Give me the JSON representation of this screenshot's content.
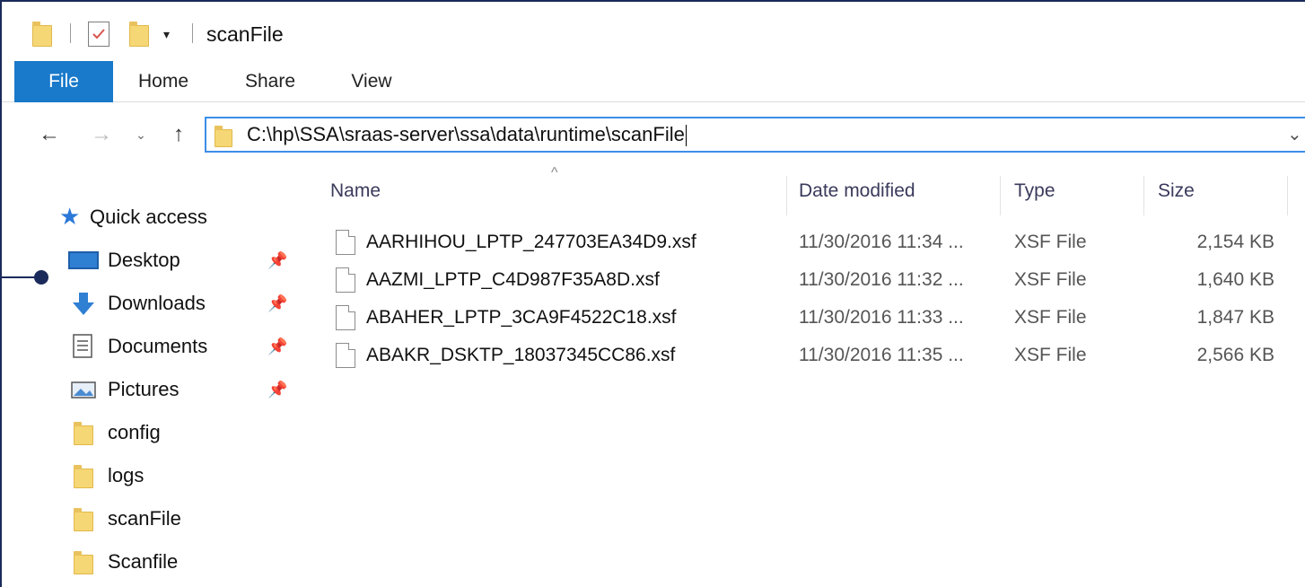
{
  "window": {
    "title": "scanFile",
    "qat_dropdown_glyph": "▾",
    "qat_icons": [
      "folder-icon",
      "properties-icon",
      "new-folder-icon"
    ]
  },
  "ribbon": {
    "tabs": [
      {
        "label": "File",
        "active": true
      },
      {
        "label": "Home"
      },
      {
        "label": "Share"
      },
      {
        "label": "View"
      }
    ],
    "active_color": "#1979ca"
  },
  "nav": {
    "back_glyph": "←",
    "forward_glyph": "→",
    "recent_glyph": "⌄",
    "up_glyph": "↑",
    "address_path": "C:\\hp\\SSA\\sraas-server\\ssa\\data\\runtime\\scanFile",
    "address_dropdown_glyph": "⌄"
  },
  "navpane": {
    "quick_access": {
      "label": "Quick access",
      "icon": "star-icon"
    },
    "pinned": [
      {
        "label": "Desktop",
        "icon": "desktop-icon",
        "pin": "📌"
      },
      {
        "label": "Downloads",
        "icon": "downloads-icon",
        "pin": "📌"
      },
      {
        "label": "Documents",
        "icon": "documents-icon",
        "pin": "📌"
      },
      {
        "label": "Pictures",
        "icon": "pictures-icon",
        "pin": "📌"
      }
    ],
    "folders": [
      {
        "label": "config",
        "icon": "folder-icon"
      },
      {
        "label": "logs",
        "icon": "folder-icon"
      },
      {
        "label": "scanFile",
        "icon": "folder-icon"
      },
      {
        "label": "Scanfile",
        "icon": "folder-icon"
      }
    ]
  },
  "content": {
    "sort_indicator": "^",
    "columns": [
      "Name",
      "Date modified",
      "Type",
      "Size"
    ],
    "files": [
      {
        "name": "AARHIHOU_LPTP_247703EA34D9.xsf",
        "date": "11/30/2016 11:34 ...",
        "type": "XSF File",
        "size": "2,154 KB"
      },
      {
        "name": "AAZMI_LPTP_C4D987F35A8D.xsf",
        "date": "11/30/2016 11:32 ...",
        "type": "XSF File",
        "size": "1,640 KB"
      },
      {
        "name": "ABAHER_LPTP_3CA9F4522C18.xsf",
        "date": "11/30/2016 11:33 ...",
        "type": "XSF File",
        "size": "1,847 KB"
      },
      {
        "name": "ABAKR_DSKTP_18037345CC86.xsf",
        "date": "11/30/2016 11:35 ...",
        "type": "XSF File",
        "size": "2,566 KB"
      }
    ]
  },
  "colors": {
    "folder": "#f6d775",
    "accent_blue": "#1979ca",
    "address_border": "#3d8ee8",
    "callout": "#1a2a5a"
  }
}
